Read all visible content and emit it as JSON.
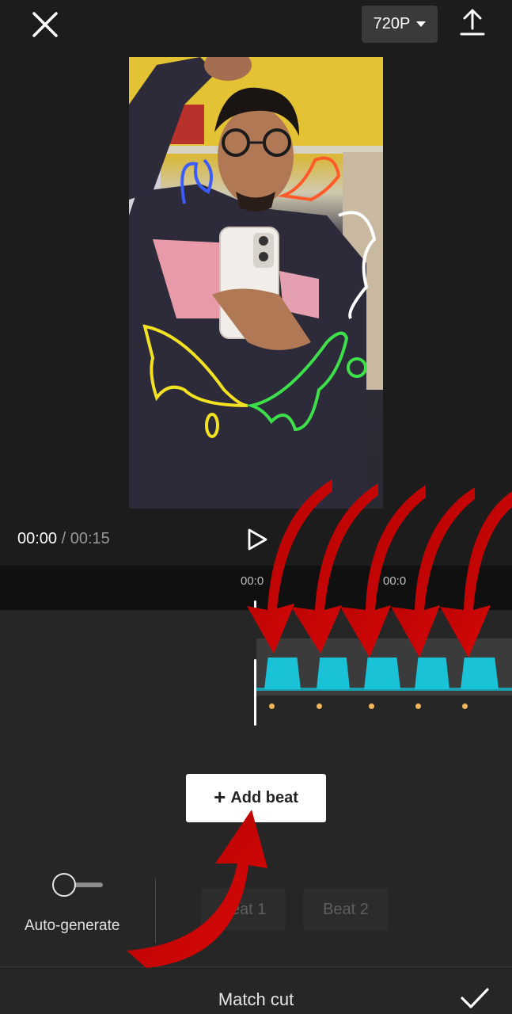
{
  "header": {
    "resolution_label": "720P",
    "close_icon": "close-icon",
    "export_icon": "upload-icon"
  },
  "player": {
    "current_time": "00:00",
    "separator": " / ",
    "total_time": "00:15",
    "play_icon": "play-icon"
  },
  "timeline": {
    "ticks": [
      "00:0",
      "00:0"
    ]
  },
  "beats_panel": {
    "add_beat_label": "Add beat",
    "add_beat_icon": "plus-icon",
    "auto_generate_label": "Auto-generate",
    "auto_generate_on": false,
    "beat_options": [
      "Beat 1",
      "Beat 2"
    ]
  },
  "footer": {
    "title": "Match cut",
    "confirm_icon": "checkmark-icon"
  },
  "colors": {
    "waveform": "#19c2d6",
    "beat_marker": "#f0b45a",
    "annotation_arrow": "#d60000"
  }
}
